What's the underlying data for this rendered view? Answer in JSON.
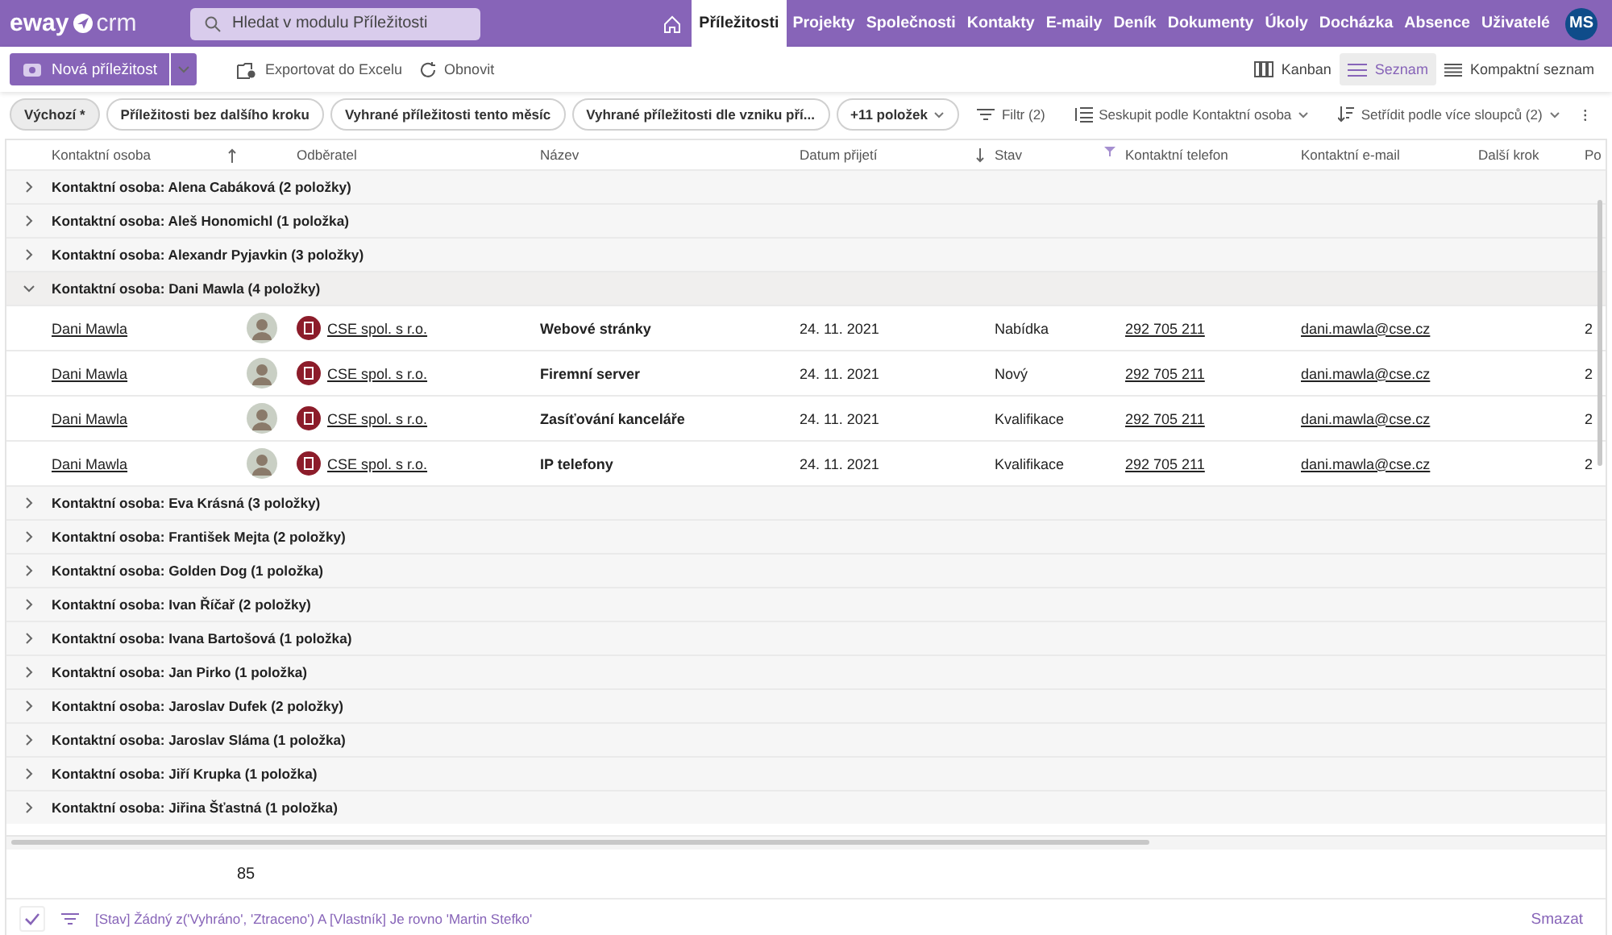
{
  "brand": {
    "part_1": "eway",
    "part_2": "crm"
  },
  "search": {
    "placeholder": "Hledat v modulu Příležitosti"
  },
  "modules": [
    {
      "label": "Příležitosti",
      "selected": true
    },
    {
      "label": "Projekty",
      "selected": false
    },
    {
      "label": "Společnosti",
      "selected": false
    },
    {
      "label": "Kontakty",
      "selected": false
    },
    {
      "label": "E-maily",
      "selected": false
    },
    {
      "label": "Deník",
      "selected": false
    },
    {
      "label": "Dokumenty",
      "selected": false
    },
    {
      "label": "Úkoly",
      "selected": false
    },
    {
      "label": "Docházka",
      "selected": false
    },
    {
      "label": "Absence",
      "selected": false
    },
    {
      "label": "Uživatelé",
      "selected": false
    }
  ],
  "user": {
    "initials": "MS"
  },
  "toolbar": {
    "new_button": "Nová příležitost",
    "export": "Exportovat do Excelu",
    "refresh": "Obnovit"
  },
  "views": [
    {
      "label": "Kanban",
      "kind": "kanban",
      "selected": false
    },
    {
      "label": "Seznam",
      "kind": "list",
      "selected": true
    },
    {
      "label": "Kompaktní seznam",
      "kind": "compact",
      "selected": false
    }
  ],
  "saved_views": [
    {
      "label": "Výchozí *",
      "selected": true
    },
    {
      "label": "Příležitosti bez dalšího kroku",
      "selected": false
    },
    {
      "label": "Vyhrané příležitosti tento měsíc",
      "selected": false
    },
    {
      "label": "Vyhrané příležitosti dle vzniku pří...",
      "selected": false
    }
  ],
  "more_views": "+11 položek",
  "list_actions": {
    "filter": "Filtr (2)",
    "group": "Seskupit podle Kontaktní osoba",
    "sort": "Setřídit podle více sloupců (2)"
  },
  "table": {
    "columns": [
      {
        "label": "Kontaktní osoba",
        "sorted": true,
        "descending": false,
        "filtered": false
      },
      {
        "label": "Odběratel",
        "sorted": false,
        "filtered": false
      },
      {
        "label": "Název",
        "sorted": false,
        "filtered": false
      },
      {
        "label": "Datum přijetí",
        "sorted": true,
        "descending": true,
        "filtered": false
      },
      {
        "label": "Stav",
        "sorted": false,
        "filtered": true
      },
      {
        "label": "Kontaktní telefon",
        "sorted": false,
        "filtered": false
      },
      {
        "label": "Kontaktní e-mail",
        "sorted": false,
        "filtered": false
      },
      {
        "label": "Další krok",
        "sorted": false,
        "filtered": false
      },
      {
        "label": "Po",
        "sorted": false,
        "filtered": false
      }
    ],
    "groups": [
      {
        "label": "Kontaktní osoba: Alena Cabáková (2 položky)",
        "expanded": false
      },
      {
        "label": "Kontaktní osoba: Aleš Honomichl (1 položka)",
        "expanded": false
      },
      {
        "label": "Kontaktní osoba: Alexandr Pyjavkin (3 položky)",
        "expanded": false
      },
      {
        "label": "Kontaktní osoba: Dani Mawla (4 položky)",
        "expanded": true,
        "rows": [
          {
            "contact": "Dani Mawla",
            "customer": "CSE spol. s r.o.",
            "name": "Webové stránky",
            "date": "24. 11. 2021",
            "status": "Nabídka",
            "phone": "292 705 211",
            "email": "dani.mawla@cse.cz",
            "column_9": "2"
          },
          {
            "contact": "Dani Mawla",
            "customer": "CSE spol. s r.o.",
            "name": "Firemní server",
            "date": "24. 11. 2021",
            "status": "Nový",
            "phone": "292 705 211",
            "email": "dani.mawla@cse.cz",
            "column_9": "2"
          },
          {
            "contact": "Dani Mawla",
            "customer": "CSE spol. s r.o.",
            "name": "Zasíťování kanceláře",
            "date": "24. 11. 2021",
            "status": "Kvalifikace",
            "phone": "292 705 211",
            "email": "dani.mawla@cse.cz",
            "column_9": "2"
          },
          {
            "contact": "Dani Mawla",
            "customer": "CSE spol. s r.o.",
            "name": "IP telefony",
            "date": "24. 11. 2021",
            "status": "Kvalifikace",
            "phone": "292 705 211",
            "email": "dani.mawla@cse.cz",
            "column_9": "2"
          }
        ]
      },
      {
        "label": "Kontaktní osoba: Eva Krásná (3 položky)",
        "expanded": false
      },
      {
        "label": "Kontaktní osoba: František Mejta (2 položky)",
        "expanded": false
      },
      {
        "label": "Kontaktní osoba: Golden Dog (1 položka)",
        "expanded": false
      },
      {
        "label": "Kontaktní osoba: Ivan Říčař (2 položky)",
        "expanded": false
      },
      {
        "label": "Kontaktní osoba: Ivana Bartošová (1 položka)",
        "expanded": false
      },
      {
        "label": "Kontaktní osoba: Jan Pirko (1 položka)",
        "expanded": false
      },
      {
        "label": "Kontaktní osoba: Jaroslav Dufek (2 položky)",
        "expanded": false
      },
      {
        "label": "Kontaktní osoba: Jaroslav Sláma (1 položka)",
        "expanded": false
      },
      {
        "label": "Kontaktní osoba: Jiří Krupka (1 položka)",
        "expanded": false
      },
      {
        "label": "Kontaktní osoba: Jiřina Šťastná (1 položka)",
        "expanded": false
      }
    ],
    "total": "85"
  },
  "active_filter": {
    "checked": true,
    "text": "[Stav] Žádný z('Vyhráno', 'Ztraceno') A [Vlastník] Je rovno 'Martin Stefko'",
    "clear": "Smazat"
  }
}
